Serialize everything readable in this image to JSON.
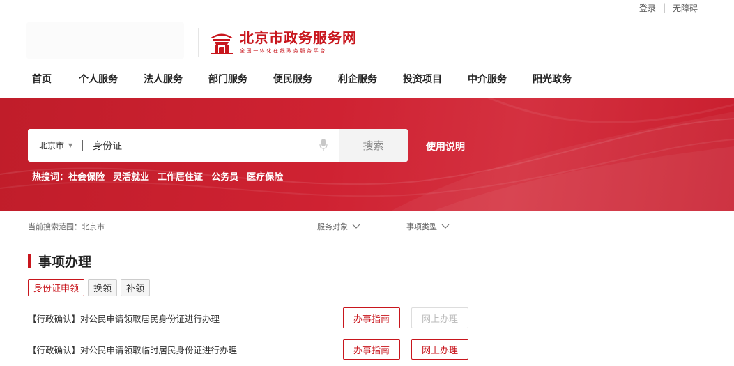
{
  "topbar": {
    "login": "登录",
    "separator": "|",
    "accessibility": "无障碍"
  },
  "brand": {
    "title": "北京市政务服务网",
    "subtitle": "全国一体化在线政务服务平台",
    "color": "#c8161d"
  },
  "nav": [
    {
      "label": "首页"
    },
    {
      "label": "个人服务"
    },
    {
      "label": "法人服务"
    },
    {
      "label": "部门服务"
    },
    {
      "label": "便民服务"
    },
    {
      "label": "利企服务"
    },
    {
      "label": "投资项目"
    },
    {
      "label": "中介服务"
    },
    {
      "label": "阳光政务"
    }
  ],
  "search": {
    "city": "北京市",
    "query": "身份证",
    "button": "搜索"
  },
  "usage_link": "使用说明",
  "hot": {
    "label": "热搜词：",
    "items": [
      "社会保险",
      "灵活就业",
      "工作居住证",
      "公务员",
      "医疗保险"
    ]
  },
  "scope": {
    "text": "当前搜索范围：北京市"
  },
  "filters": {
    "service_object": "服务对象",
    "item_type": "事项类型"
  },
  "section": {
    "title": "事项办理"
  },
  "tags": [
    {
      "label": "身份证申领",
      "active": true
    },
    {
      "label": "换领"
    },
    {
      "label": "补领"
    }
  ],
  "items": [
    {
      "text": "【行政确认】对公民申请领取居民身份证进行办理",
      "guide": "办事指南",
      "online": "网上办理",
      "online_enabled": false
    },
    {
      "text": "【行政确认】对公民申请领取临时居民身份证进行办理",
      "guide": "办事指南",
      "online": "网上办理",
      "online_enabled": true
    }
  ]
}
